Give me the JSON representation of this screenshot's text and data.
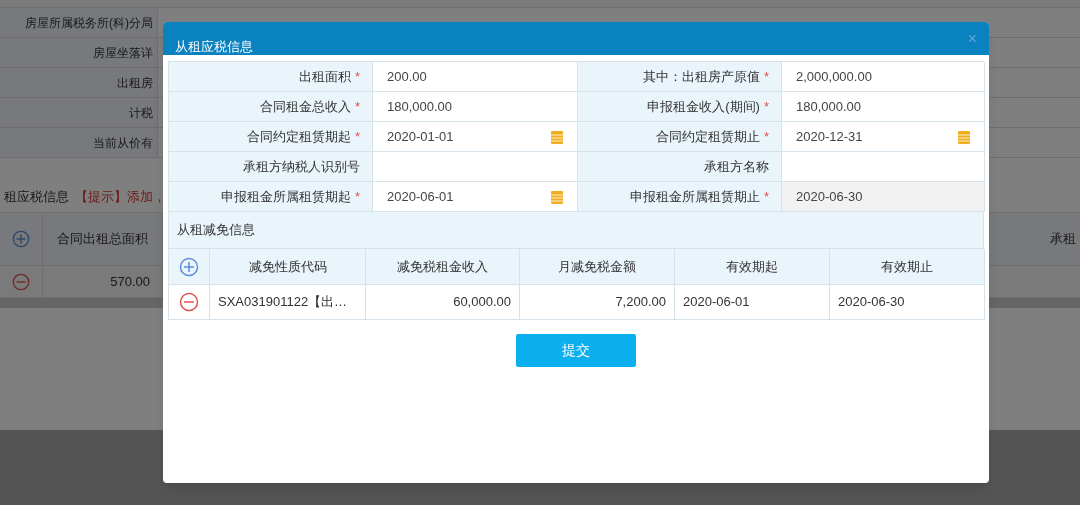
{
  "background": {
    "form_labels": [
      "房屋所属税务所(科)分局",
      "房屋坐落详",
      "出租房",
      "计税",
      "当前从价有"
    ],
    "section_title": "租应税信息",
    "hint": "【提示】添加，",
    "table": {
      "columns": [
        "合同出租总面积"
      ],
      "rows": [
        [
          "570.00"
        ]
      ],
      "column_2": "承租"
    }
  },
  "dialog": {
    "title": "从租应税信息",
    "close": "×",
    "fields": [
      {
        "label": "出租面积",
        "mark": "*",
        "value": "200.00",
        "kind": "text",
        "readonly": false
      },
      {
        "label": "其中：出租房产原值",
        "mark": "*",
        "value": "2,000,000.00",
        "kind": "text",
        "readonly": false
      },
      {
        "label": "合同租金总收入",
        "mark": "*",
        "value": "180,000.00",
        "kind": "text",
        "readonly": false
      },
      {
        "label": "申报租金收入(期间)",
        "mark": "*",
        "value": "180,000.00",
        "kind": "text",
        "readonly": false
      },
      {
        "label": "合同约定租赁期起",
        "mark": "*",
        "value": "2020-01-01",
        "kind": "date",
        "readonly": false
      },
      {
        "label": "合同约定租赁期止",
        "mark": "*",
        "value": "2020-12-31",
        "kind": "date",
        "readonly": false
      },
      {
        "label": "承租方纳税人识别号",
        "kind": "text",
        "readonly": false
      },
      {
        "label": "承租方名称",
        "kind": "text",
        "readonly": false
      },
      {
        "label": "申报租金所属租赁期起",
        "mark": "*",
        "value": "2020-06-01",
        "kind": "date",
        "readonly": false
      },
      {
        "label": "申报租金所属租赁期止",
        "mark": "*",
        "value": "2020-06-30",
        "kind": "text",
        "readonly": true
      }
    ],
    "relief": {
      "title": "从租减免信息",
      "columns": [
        "减免性质代码",
        "减免税租金收入",
        "月减免税金额",
        "有效期起",
        "有效期止"
      ],
      "rows": [
        [
          "SXA031901122【出…",
          "60,000.00",
          "7,200.00",
          "2020-06-01",
          "2020-06-30"
        ]
      ]
    },
    "submit": "提交"
  }
}
